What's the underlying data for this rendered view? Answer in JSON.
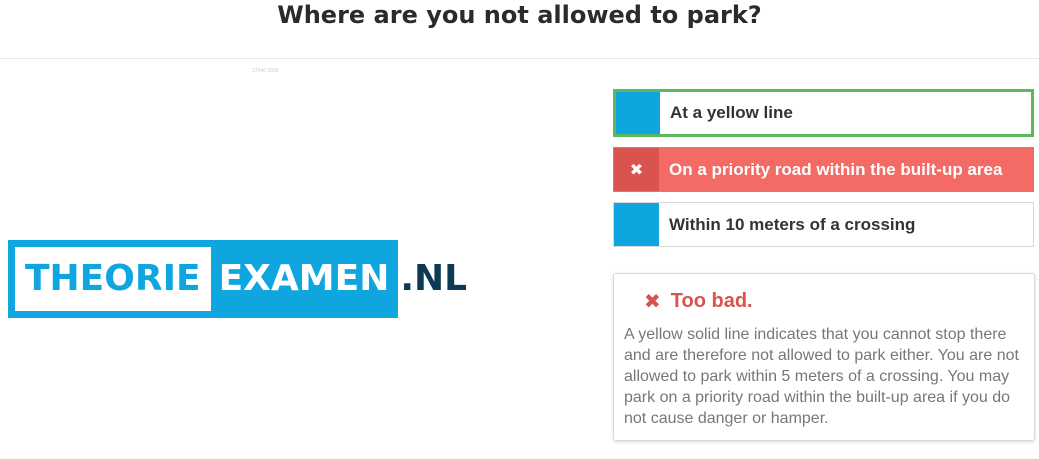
{
  "question": "Where are you not allowed to park?",
  "image": {
    "credit": "27046 3309",
    "logo": {
      "part1": "THEORIE",
      "part2": "EXAMEN",
      "tld": ".NL"
    }
  },
  "answers": [
    {
      "label": "At a yellow line",
      "state": "correct",
      "marker": ""
    },
    {
      "label": "On a priority road within the built-up area",
      "state": "wrong",
      "marker": "✖"
    },
    {
      "label": "Within 10 meters of a crossing",
      "state": "neutral",
      "marker": ""
    }
  ],
  "feedback": {
    "icon": "✖",
    "title": "Too bad.",
    "text": "A yellow solid line indicates that you cannot stop there and are therefore not allowed to park either. You are not allowed to park within 5 meters of a crossing. You may park on a priority road within the built-up area if you do not cause danger or hamper."
  },
  "colors": {
    "accent": "#0fa5de",
    "correct": "#5cb85c",
    "wrong": "#d9534f",
    "wrong_light": "#f46a65",
    "logo_tld": "#0b3a52"
  }
}
